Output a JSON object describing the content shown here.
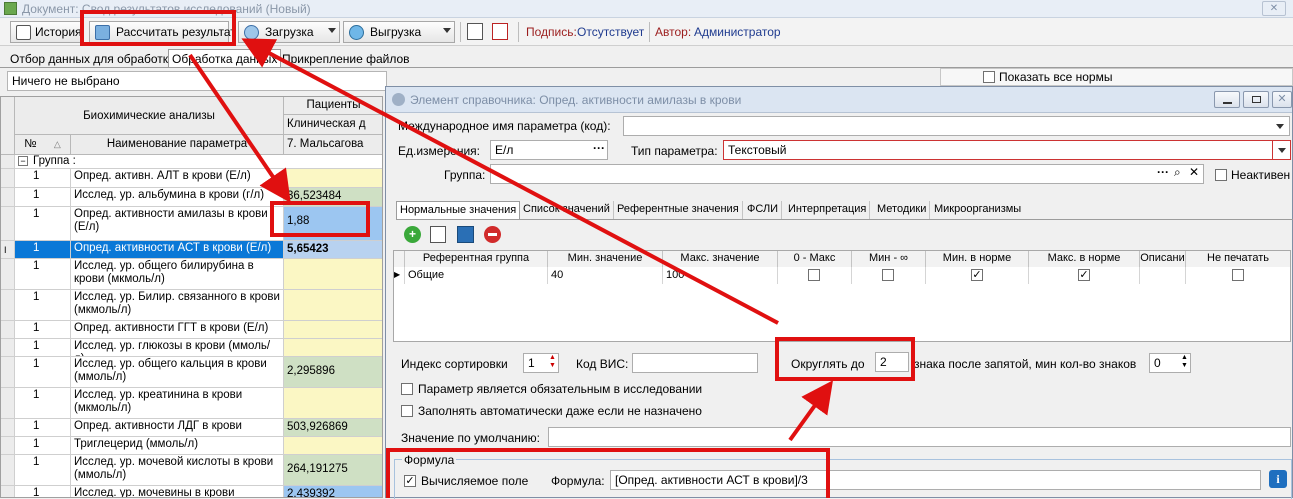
{
  "window": {
    "title": "Документ: Свод результатов исследований (Новый)",
    "close_icon": "✕"
  },
  "toolbar": {
    "history_label": "История",
    "calculate_label": "Рассчитать результат",
    "load_label": "Загрузка",
    "export_label": "Выгрузка",
    "signature_label": "Подпись:",
    "signature_value": "Отсутствует",
    "author_label": "Автор:",
    "author_value": "Администратор"
  },
  "main_tabs": [
    "Отбор данных для обработки",
    "Обработка данных",
    "Прикрепление файлов"
  ],
  "filter": {
    "value": "Ничего не выбрано"
  },
  "right_strip": {
    "show_all_norms": "Показать все нормы"
  },
  "grid": {
    "header_group": "Биохимические анализы",
    "col_num": "№",
    "col_name": "Наименование параметра",
    "patients_header": "Пациенты",
    "clinic_header": "Клиническая д",
    "patient_name": "7. Мальсагова",
    "group_row": "Группа :",
    "rows": [
      {
        "num": "1",
        "name": "Опред. активн. АЛТ в крови (Е/л)",
        "value": ""
      },
      {
        "num": "1",
        "name": "Исслед. ур. альбумина в крови (г/л)",
        "value": "36,523484"
      },
      {
        "num": "1",
        "name": "Опред. активности амилазы в крови (Е/л)",
        "value": "1,88"
      },
      {
        "num": "1",
        "name": "Опред. активности АСТ в крови (Е/л)",
        "value": "5,65423"
      },
      {
        "num": "1",
        "name": "Исслед. ур. общего билирубина в крови (мкмоль/л)",
        "value": ""
      },
      {
        "num": "1",
        "name": "Исслед. ур. Билир. связанного в крови (мкмоль/л)",
        "value": ""
      },
      {
        "num": "1",
        "name": "Опред. активности ГГТ в крови (Е/л)",
        "value": ""
      },
      {
        "num": "1",
        "name": "Исслед. ур. глюкозы в крови (ммоль/л)",
        "value": ""
      },
      {
        "num": "1",
        "name": "Исслед. ур. общего кальция в крови (ммоль/л)",
        "value": "2,295896"
      },
      {
        "num": "1",
        "name": "Исслед. ур. креатинина в крови (мкмоль/л)",
        "value": ""
      },
      {
        "num": "1",
        "name": "Опред. активности ЛДГ в крови",
        "value": "503,926869"
      },
      {
        "num": "1",
        "name": "Триглецерид (ммоль/л)",
        "value": ""
      },
      {
        "num": "1",
        "name": "Исслед. ур. мочевой кислоты в крови (ммоль/л)",
        "value": "264,191275"
      },
      {
        "num": "1",
        "name": "Исслед. ур. мочевины в крови",
        "value": "2,439392"
      }
    ]
  },
  "dialog": {
    "title": "Элемент справочника: Опред. активности амилазы в крови",
    "intl_name_label": "Международное имя параметра (код):",
    "intl_name_value": "",
    "unit_label": "Ед.измерения:",
    "unit_value": "Е/л",
    "param_type_label": "Тип параметра:",
    "param_type_value": "Текстовый",
    "group_label": "Группа:",
    "group_value": "",
    "inactive_label": "Неактивен",
    "tabs": [
      "Нормальные значения",
      "Список значений",
      "Референтные значения",
      "ФСЛИ",
      "Интерпретация",
      "Методики",
      "Микроорганизмы"
    ],
    "norm_table": {
      "headers": [
        "Референтная группа",
        "Мин. значение",
        "Макс. значение",
        "0 - Макс",
        "Мин - ∞",
        "Мин. в норме",
        "Макс. в норме",
        "Описани",
        "Не печатать"
      ],
      "row": {
        "group": "Общие",
        "min": "40",
        "max": "100"
      }
    },
    "sort_index_label": "Индекс сортировки",
    "sort_index_value": "1",
    "vis_code_label": "Код ВИС:",
    "vis_code_value": "",
    "round_label": "Округлять до",
    "round_value": "2",
    "round_suffix": "знака после запятой, мин кол-во знаков",
    "min_digits_value": "0",
    "required_label": "Параметр является обязательным в исследовании",
    "autofill_label": "Заполнять автоматически даже если не назначено",
    "default_label": "Значение по умолчанию:",
    "default_value": "",
    "formula_group": "Формула",
    "computed_label": "Вычисляемое поле",
    "formula_label": "Формула:",
    "formula_value": "[Опред. активности АСТ в крови]/3"
  },
  "colors": {
    "highlight": "#e01010",
    "selection": "#0a78d7"
  }
}
